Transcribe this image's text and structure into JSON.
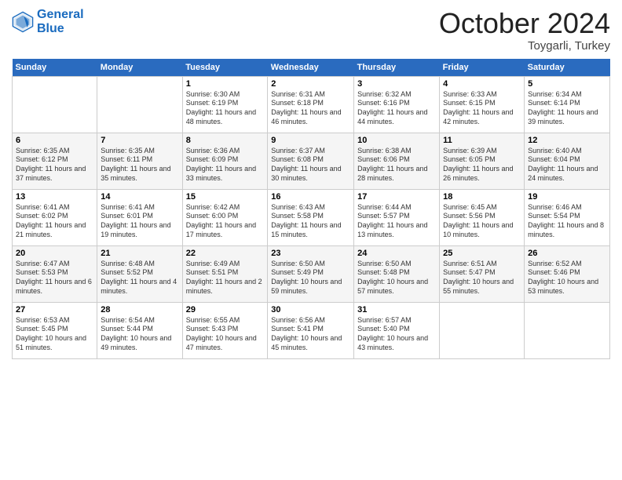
{
  "header": {
    "logo_line1": "General",
    "logo_line2": "Blue",
    "month_title": "October 2024",
    "location": "Toygarli, Turkey"
  },
  "days_of_week": [
    "Sunday",
    "Monday",
    "Tuesday",
    "Wednesday",
    "Thursday",
    "Friday",
    "Saturday"
  ],
  "weeks": [
    [
      null,
      null,
      {
        "day": "1",
        "sunrise": "6:30 AM",
        "sunset": "6:19 PM",
        "daylight": "11 hours and 48 minutes."
      },
      {
        "day": "2",
        "sunrise": "6:31 AM",
        "sunset": "6:18 PM",
        "daylight": "11 hours and 46 minutes."
      },
      {
        "day": "3",
        "sunrise": "6:32 AM",
        "sunset": "6:16 PM",
        "daylight": "11 hours and 44 minutes."
      },
      {
        "day": "4",
        "sunrise": "6:33 AM",
        "sunset": "6:15 PM",
        "daylight": "11 hours and 42 minutes."
      },
      {
        "day": "5",
        "sunrise": "6:34 AM",
        "sunset": "6:14 PM",
        "daylight": "11 hours and 39 minutes."
      }
    ],
    [
      {
        "day": "6",
        "sunrise": "6:35 AM",
        "sunset": "6:12 PM",
        "daylight": "11 hours and 37 minutes."
      },
      {
        "day": "7",
        "sunrise": "6:35 AM",
        "sunset": "6:11 PM",
        "daylight": "11 hours and 35 minutes."
      },
      {
        "day": "8",
        "sunrise": "6:36 AM",
        "sunset": "6:09 PM",
        "daylight": "11 hours and 33 minutes."
      },
      {
        "day": "9",
        "sunrise": "6:37 AM",
        "sunset": "6:08 PM",
        "daylight": "11 hours and 30 minutes."
      },
      {
        "day": "10",
        "sunrise": "6:38 AM",
        "sunset": "6:06 PM",
        "daylight": "11 hours and 28 minutes."
      },
      {
        "day": "11",
        "sunrise": "6:39 AM",
        "sunset": "6:05 PM",
        "daylight": "11 hours and 26 minutes."
      },
      {
        "day": "12",
        "sunrise": "6:40 AM",
        "sunset": "6:04 PM",
        "daylight": "11 hours and 24 minutes."
      }
    ],
    [
      {
        "day": "13",
        "sunrise": "6:41 AM",
        "sunset": "6:02 PM",
        "daylight": "11 hours and 21 minutes."
      },
      {
        "day": "14",
        "sunrise": "6:41 AM",
        "sunset": "6:01 PM",
        "daylight": "11 hours and 19 minutes."
      },
      {
        "day": "15",
        "sunrise": "6:42 AM",
        "sunset": "6:00 PM",
        "daylight": "11 hours and 17 minutes."
      },
      {
        "day": "16",
        "sunrise": "6:43 AM",
        "sunset": "5:58 PM",
        "daylight": "11 hours and 15 minutes."
      },
      {
        "day": "17",
        "sunrise": "6:44 AM",
        "sunset": "5:57 PM",
        "daylight": "11 hours and 13 minutes."
      },
      {
        "day": "18",
        "sunrise": "6:45 AM",
        "sunset": "5:56 PM",
        "daylight": "11 hours and 10 minutes."
      },
      {
        "day": "19",
        "sunrise": "6:46 AM",
        "sunset": "5:54 PM",
        "daylight": "11 hours and 8 minutes."
      }
    ],
    [
      {
        "day": "20",
        "sunrise": "6:47 AM",
        "sunset": "5:53 PM",
        "daylight": "11 hours and 6 minutes."
      },
      {
        "day": "21",
        "sunrise": "6:48 AM",
        "sunset": "5:52 PM",
        "daylight": "11 hours and 4 minutes."
      },
      {
        "day": "22",
        "sunrise": "6:49 AM",
        "sunset": "5:51 PM",
        "daylight": "11 hours and 2 minutes."
      },
      {
        "day": "23",
        "sunrise": "6:50 AM",
        "sunset": "5:49 PM",
        "daylight": "10 hours and 59 minutes."
      },
      {
        "day": "24",
        "sunrise": "6:50 AM",
        "sunset": "5:48 PM",
        "daylight": "10 hours and 57 minutes."
      },
      {
        "day": "25",
        "sunrise": "6:51 AM",
        "sunset": "5:47 PM",
        "daylight": "10 hours and 55 minutes."
      },
      {
        "day": "26",
        "sunrise": "6:52 AM",
        "sunset": "5:46 PM",
        "daylight": "10 hours and 53 minutes."
      }
    ],
    [
      {
        "day": "27",
        "sunrise": "6:53 AM",
        "sunset": "5:45 PM",
        "daylight": "10 hours and 51 minutes."
      },
      {
        "day": "28",
        "sunrise": "6:54 AM",
        "sunset": "5:44 PM",
        "daylight": "10 hours and 49 minutes."
      },
      {
        "day": "29",
        "sunrise": "6:55 AM",
        "sunset": "5:43 PM",
        "daylight": "10 hours and 47 minutes."
      },
      {
        "day": "30",
        "sunrise": "6:56 AM",
        "sunset": "5:41 PM",
        "daylight": "10 hours and 45 minutes."
      },
      {
        "day": "31",
        "sunrise": "6:57 AM",
        "sunset": "5:40 PM",
        "daylight": "10 hours and 43 minutes."
      },
      null,
      null
    ]
  ],
  "labels": {
    "sunrise_prefix": "Sunrise: ",
    "sunset_prefix": "Sunset: ",
    "daylight_prefix": "Daylight: "
  }
}
